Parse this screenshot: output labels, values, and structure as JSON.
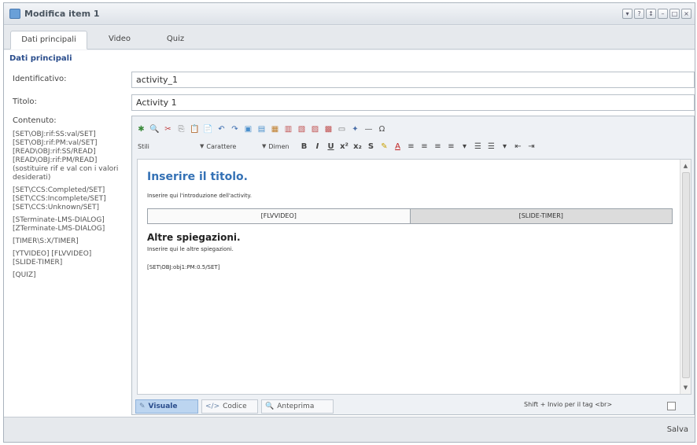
{
  "window": {
    "title": "Modifica item 1",
    "controls": [
      "▾",
      "?",
      "↕",
      "–",
      "□",
      "×"
    ]
  },
  "tabs": [
    {
      "label": "Dati principali",
      "active": true
    },
    {
      "label": "Video",
      "active": false
    },
    {
      "label": "Quiz",
      "active": false
    }
  ],
  "section": {
    "title": "Dati principali"
  },
  "fields": {
    "identificativo": {
      "label": "Identificativo:",
      "value": "activity_1"
    },
    "titolo": {
      "label": "Titolo:",
      "value": "Activity 1"
    },
    "contenuto": {
      "label": "Contenuto:"
    }
  },
  "hints": [
    "[SET\\OBJ:rif:SS:val/SET]\n[SET\\OBJ:rif:PM:val/SET]\n[READ\\OBJ:rif:SS/READ]\n[READ\\OBJ:rif:PM/READ]\n(sostituire rif e val con i valori desiderati)",
    "[SET\\CCS:Completed/SET]\n[SET\\CCS:Incomplete/SET]\n[SET\\CCS:Unknown/SET]",
    "[STerminate-LMS-DIALOG]\n[ZTerminate-LMS-DIALOG]",
    "[TIMER\\S:X/TIMER]",
    "[YTVIDEO] [FLVVIDEO]\n[SLIDE-TIMER]",
    "[QUIZ]"
  ],
  "editor": {
    "toolbar1_icons": [
      "flash-icon",
      "find-icon",
      "cut-icon",
      "copy-icon",
      "paste-icon",
      "paste-text-icon",
      "undo-icon",
      "redo-icon",
      "image-icon",
      "media-icon",
      "table-icon",
      "table-row-icon",
      "table-col-icon",
      "table-merge-icon",
      "table-delete-icon",
      "hr-icon",
      "anchor-icon",
      "line-icon",
      "special-char-icon"
    ],
    "toolbar1_glyphs": [
      "✱",
      "🔍",
      "✂",
      "⎘",
      "📋",
      "📄",
      "↶",
      "↷",
      "▣",
      "▤",
      "▦",
      "▥",
      "▧",
      "▨",
      "▩",
      "▭",
      "✦",
      "—",
      "Ω"
    ],
    "combos": {
      "styles": "Stili",
      "font": "Carattere",
      "size": "Dimen"
    },
    "format_buttons": [
      "B",
      "I",
      "U",
      "x²",
      "x₂",
      "S",
      "✎",
      "A",
      "≡",
      "≡",
      "≡",
      "≡",
      "▾",
      "☰",
      "☰",
      "▾",
      "⇤",
      "⇥"
    ],
    "content": {
      "heading": "Inserire il titolo.",
      "intro": "Inserire qui l'introduzione dell'activity.",
      "table_cells": [
        "[FLVVIDEO]",
        "[SLIDE-TIMER]"
      ],
      "subheading": "Altre spiegazioni.",
      "text": "Inserire qui le altre spiegazioni.",
      "set_code": "[SET\\OBJ:obj1:PM:0.5/SET]"
    },
    "mode_tabs": [
      {
        "label": "Visuale",
        "icon": "✎",
        "active": true
      },
      {
        "label": "Codice",
        "icon": "</>",
        "active": false
      },
      {
        "label": "Anteprima",
        "icon": "🔍",
        "active": false
      }
    ],
    "shift_hint": "Shift + Invio per il tag <br>"
  },
  "footer": {
    "save_label": "Salva"
  }
}
